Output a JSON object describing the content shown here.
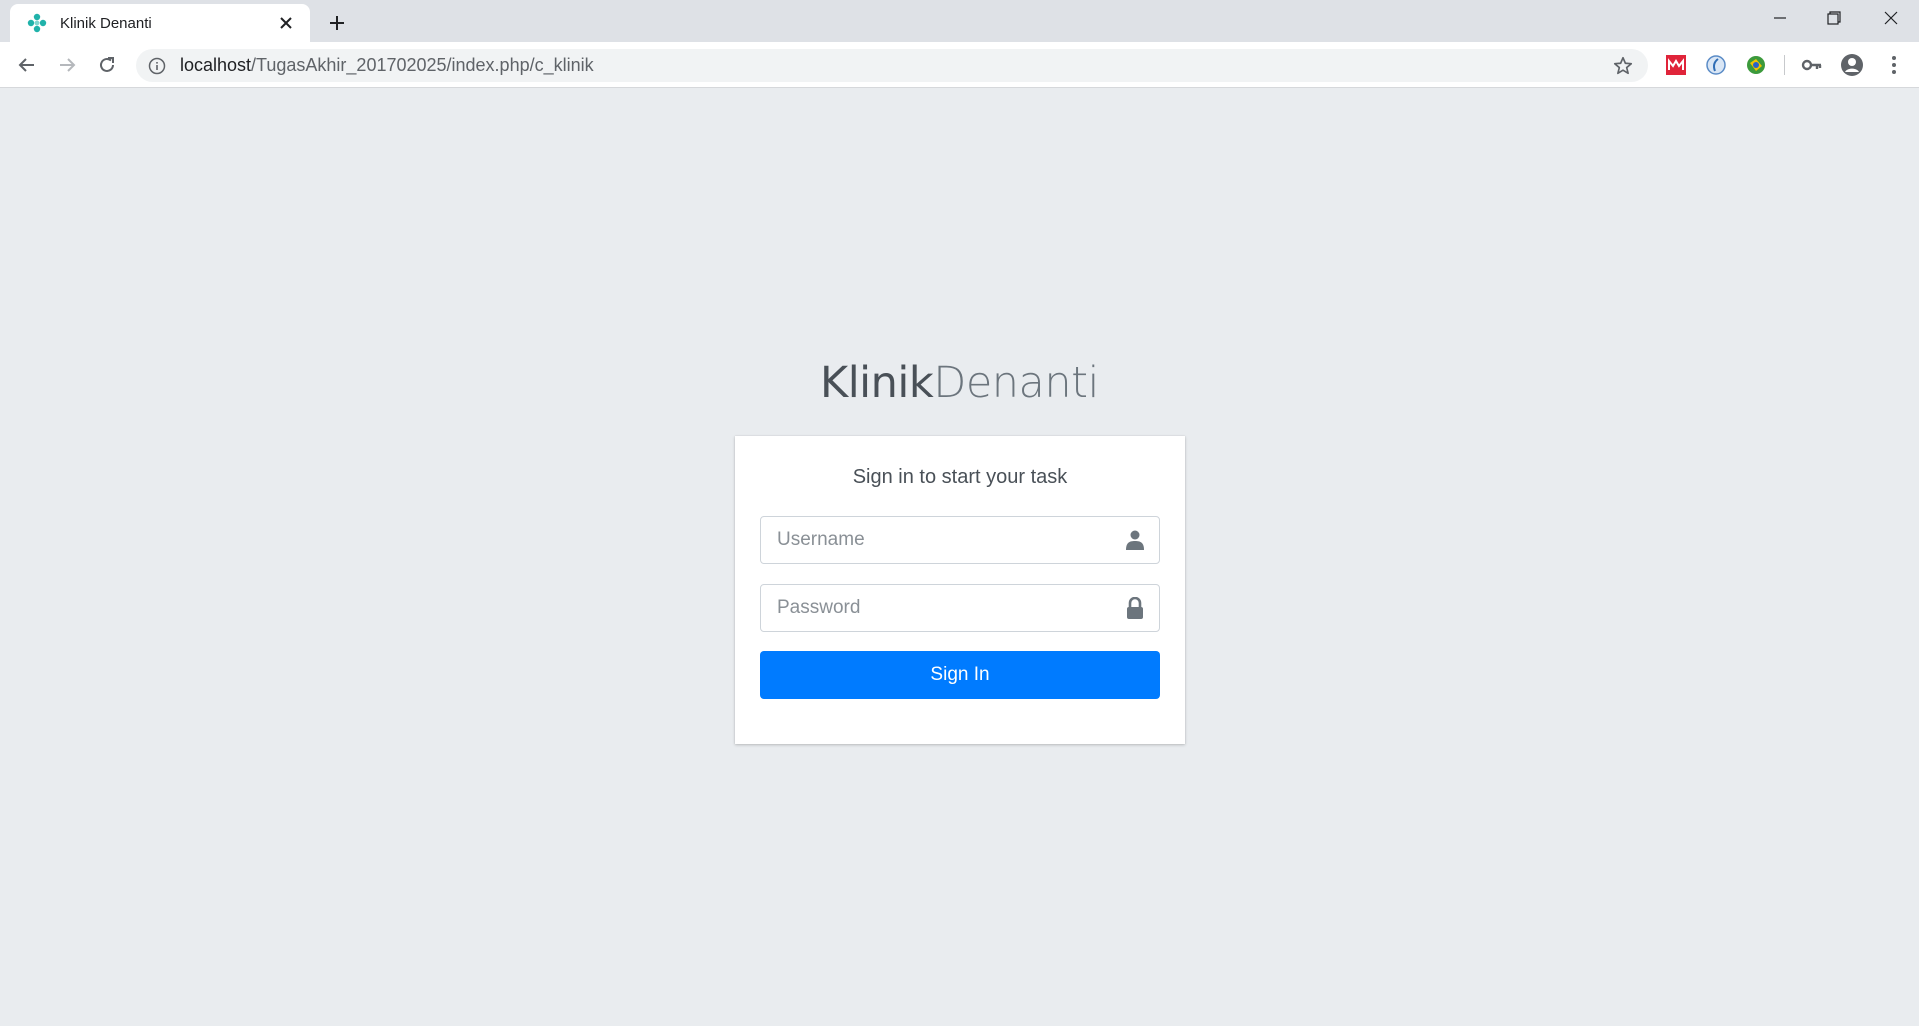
{
  "browser": {
    "tab": {
      "title": "Klinik Denanti"
    },
    "address": {
      "host": "localhost",
      "path": "/TugasAkhir_201702025/index.php/c_klinik"
    }
  },
  "login": {
    "logo_bold": "Klinik",
    "logo_light": "Denanti",
    "message": "Sign in to start your task",
    "username_placeholder": "Username",
    "password_placeholder": "Password",
    "signin_label": "Sign In"
  },
  "colors": {
    "page_bg": "#e9ecef",
    "primary": "#007bff",
    "favicon": "#20b2aa"
  },
  "icons": {
    "username_field": "user-icon",
    "password_field": "lock-icon"
  }
}
